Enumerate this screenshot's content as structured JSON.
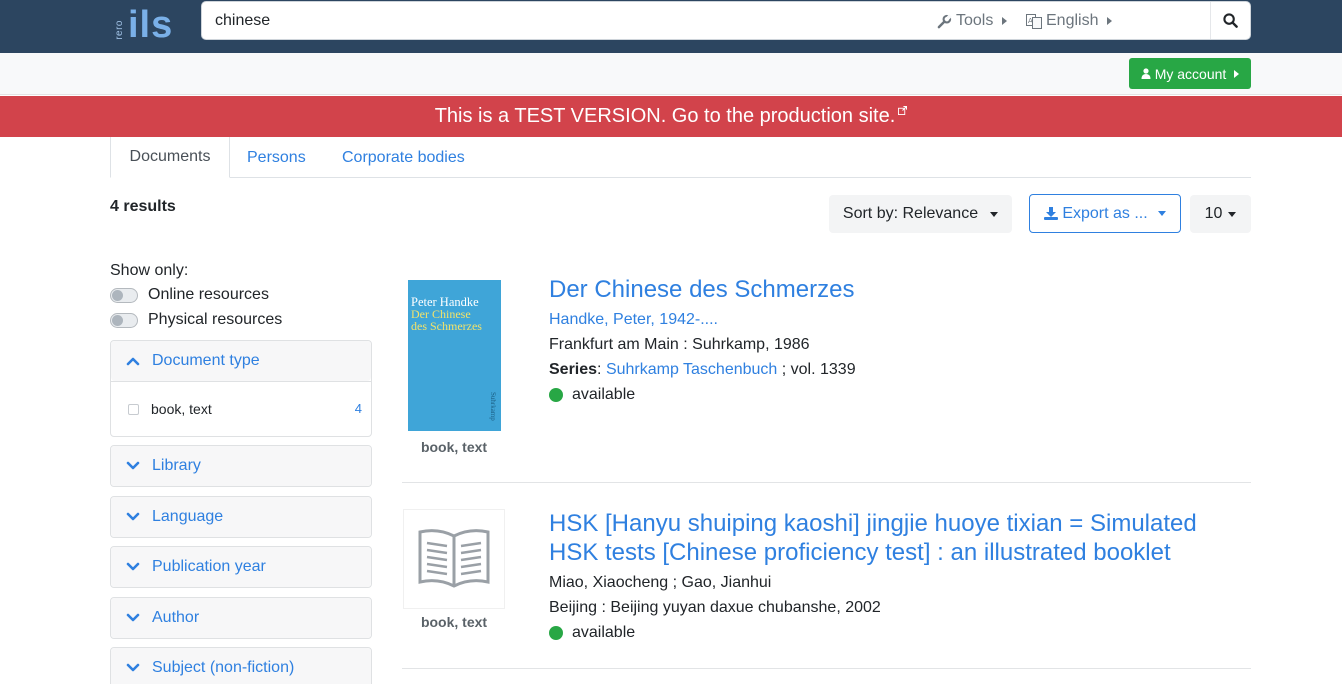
{
  "header": {
    "logo_small": "rero",
    "logo_main": "ils",
    "search_value": "chinese",
    "search_placeholder": ""
  },
  "subnav": {
    "tools_label": "Tools",
    "language_label": "English",
    "account_label": "My account"
  },
  "banner": {
    "text": "This is a TEST VERSION. Go to the production site."
  },
  "tabs": [
    {
      "label": "Documents"
    },
    {
      "label": "Persons"
    },
    {
      "label": "Corporate bodies"
    }
  ],
  "toolbar": {
    "results_count": "4 results",
    "sort_label": "Sort by: Relevance",
    "export_label": "Export as ...",
    "per_page": "10"
  },
  "sidebar": {
    "show_only_label": "Show only:",
    "toggles": [
      {
        "label": "Online resources"
      },
      {
        "label": "Physical resources"
      }
    ],
    "facets": [
      {
        "label": "Document type",
        "expanded": true,
        "items": [
          {
            "label": "book, text",
            "count": "4"
          }
        ]
      },
      {
        "label": "Library"
      },
      {
        "label": "Language"
      },
      {
        "label": "Publication year"
      },
      {
        "label": "Author"
      },
      {
        "label": "Subject (non-fiction)"
      }
    ]
  },
  "results": [
    {
      "title": "Der Chinese des Schmerzes",
      "author": "Handke, Peter, 1942-....",
      "publication": "Frankfurt am Main : Suhrkamp, 1986",
      "series_label": "Series",
      "series_link": "Suhrkamp Taschenbuch",
      "series_vol": " ; vol. 1339",
      "status": "available",
      "doc_type": "book, text",
      "cover_author": "Peter Handke",
      "cover_title_1": "Der Chinese",
      "cover_title_2": "des Schmerzes",
      "cover_spine": "Suhrkamp"
    },
    {
      "title_line1": "HSK [Hanyu shuiping kaoshi] jingjie huoye tixian = Simulated",
      "title_line2": "HSK tests [Chinese proficiency test] : an illustrated booklet",
      "author": "Miao, Xiaocheng ;  Gao, Jianhui",
      "publication": "Beijing : Beijing yuyan daxue chubanshe, 2002",
      "status": "available",
      "doc_type": "book, text"
    }
  ],
  "colors": {
    "topbar": "#2c4560",
    "banner": "#d2434b",
    "link": "#2f80e0",
    "account": "#28a745",
    "available": "#28a745"
  }
}
